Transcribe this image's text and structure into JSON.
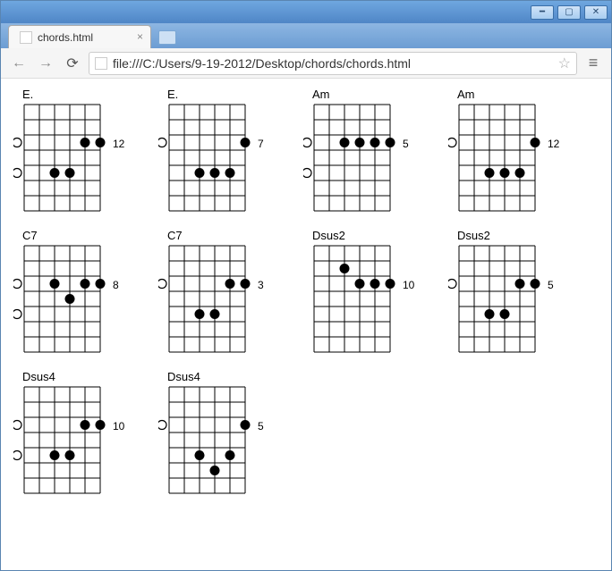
{
  "window": {
    "tab_title": "chords.html",
    "url": "file:///C:/Users/9-19-2012/Desktop/chords/chords.html"
  },
  "diagram": {
    "strings": 6,
    "frets": 7,
    "open_string_col": 0
  },
  "chords": [
    {
      "name": "E.",
      "fret_label": "12",
      "open": [
        3,
        5
      ],
      "dots": [
        {
          "s": 2,
          "f": 5
        },
        {
          "s": 3,
          "f": 5
        },
        {
          "s": 4,
          "f": 3
        },
        {
          "s": 5,
          "f": 3
        }
      ]
    },
    {
      "name": "E.",
      "fret_label": "7",
      "open": [
        3
      ],
      "dots": [
        {
          "s": 2,
          "f": 5
        },
        {
          "s": 3,
          "f": 5
        },
        {
          "s": 4,
          "f": 5
        },
        {
          "s": 5,
          "f": 3
        }
      ]
    },
    {
      "name": "Am",
      "fret_label": "5",
      "open": [
        3,
        5
      ],
      "dots": [
        {
          "s": 2,
          "f": 3
        },
        {
          "s": 3,
          "f": 3
        },
        {
          "s": 4,
          "f": 3
        },
        {
          "s": 5,
          "f": 3
        }
      ]
    },
    {
      "name": "Am",
      "fret_label": "12",
      "open": [
        3
      ],
      "dots": [
        {
          "s": 2,
          "f": 5
        },
        {
          "s": 3,
          "f": 5
        },
        {
          "s": 4,
          "f": 5
        },
        {
          "s": 5,
          "f": 3
        }
      ]
    },
    {
      "name": "C7",
      "fret_label": "8",
      "open": [
        3,
        5
      ],
      "dots": [
        {
          "s": 2,
          "f": 3
        },
        {
          "s": 3,
          "f": 4
        },
        {
          "s": 4,
          "f": 3
        },
        {
          "s": 5,
          "f": 3
        }
      ]
    },
    {
      "name": "C7",
      "fret_label": "3",
      "open": [
        3
      ],
      "dots": [
        {
          "s": 2,
          "f": 5
        },
        {
          "s": 3,
          "f": 5
        },
        {
          "s": 4,
          "f": 3
        },
        {
          "s": 5,
          "f": 3
        }
      ]
    },
    {
      "name": "Dsus2",
      "fret_label": "10",
      "open": [],
      "dots": [
        {
          "s": 2,
          "f": 2
        },
        {
          "s": 3,
          "f": 3
        },
        {
          "s": 4,
          "f": 3
        },
        {
          "s": 5,
          "f": 3
        }
      ]
    },
    {
      "name": "Dsus2",
      "fret_label": "5",
      "open": [
        3
      ],
      "dots": [
        {
          "s": 2,
          "f": 5
        },
        {
          "s": 3,
          "f": 5
        },
        {
          "s": 4,
          "f": 3
        },
        {
          "s": 5,
          "f": 3
        }
      ]
    },
    {
      "name": "Dsus4",
      "fret_label": "10",
      "open": [
        3,
        5
      ],
      "dots": [
        {
          "s": 2,
          "f": 5
        },
        {
          "s": 3,
          "f": 5
        },
        {
          "s": 4,
          "f": 3
        },
        {
          "s": 5,
          "f": 3
        }
      ]
    },
    {
      "name": "Dsus4",
      "fret_label": "5",
      "open": [
        3
      ],
      "dots": [
        {
          "s": 2,
          "f": 5
        },
        {
          "s": 3,
          "f": 6
        },
        {
          "s": 4,
          "f": 5
        },
        {
          "s": 5,
          "f": 3
        }
      ]
    }
  ]
}
